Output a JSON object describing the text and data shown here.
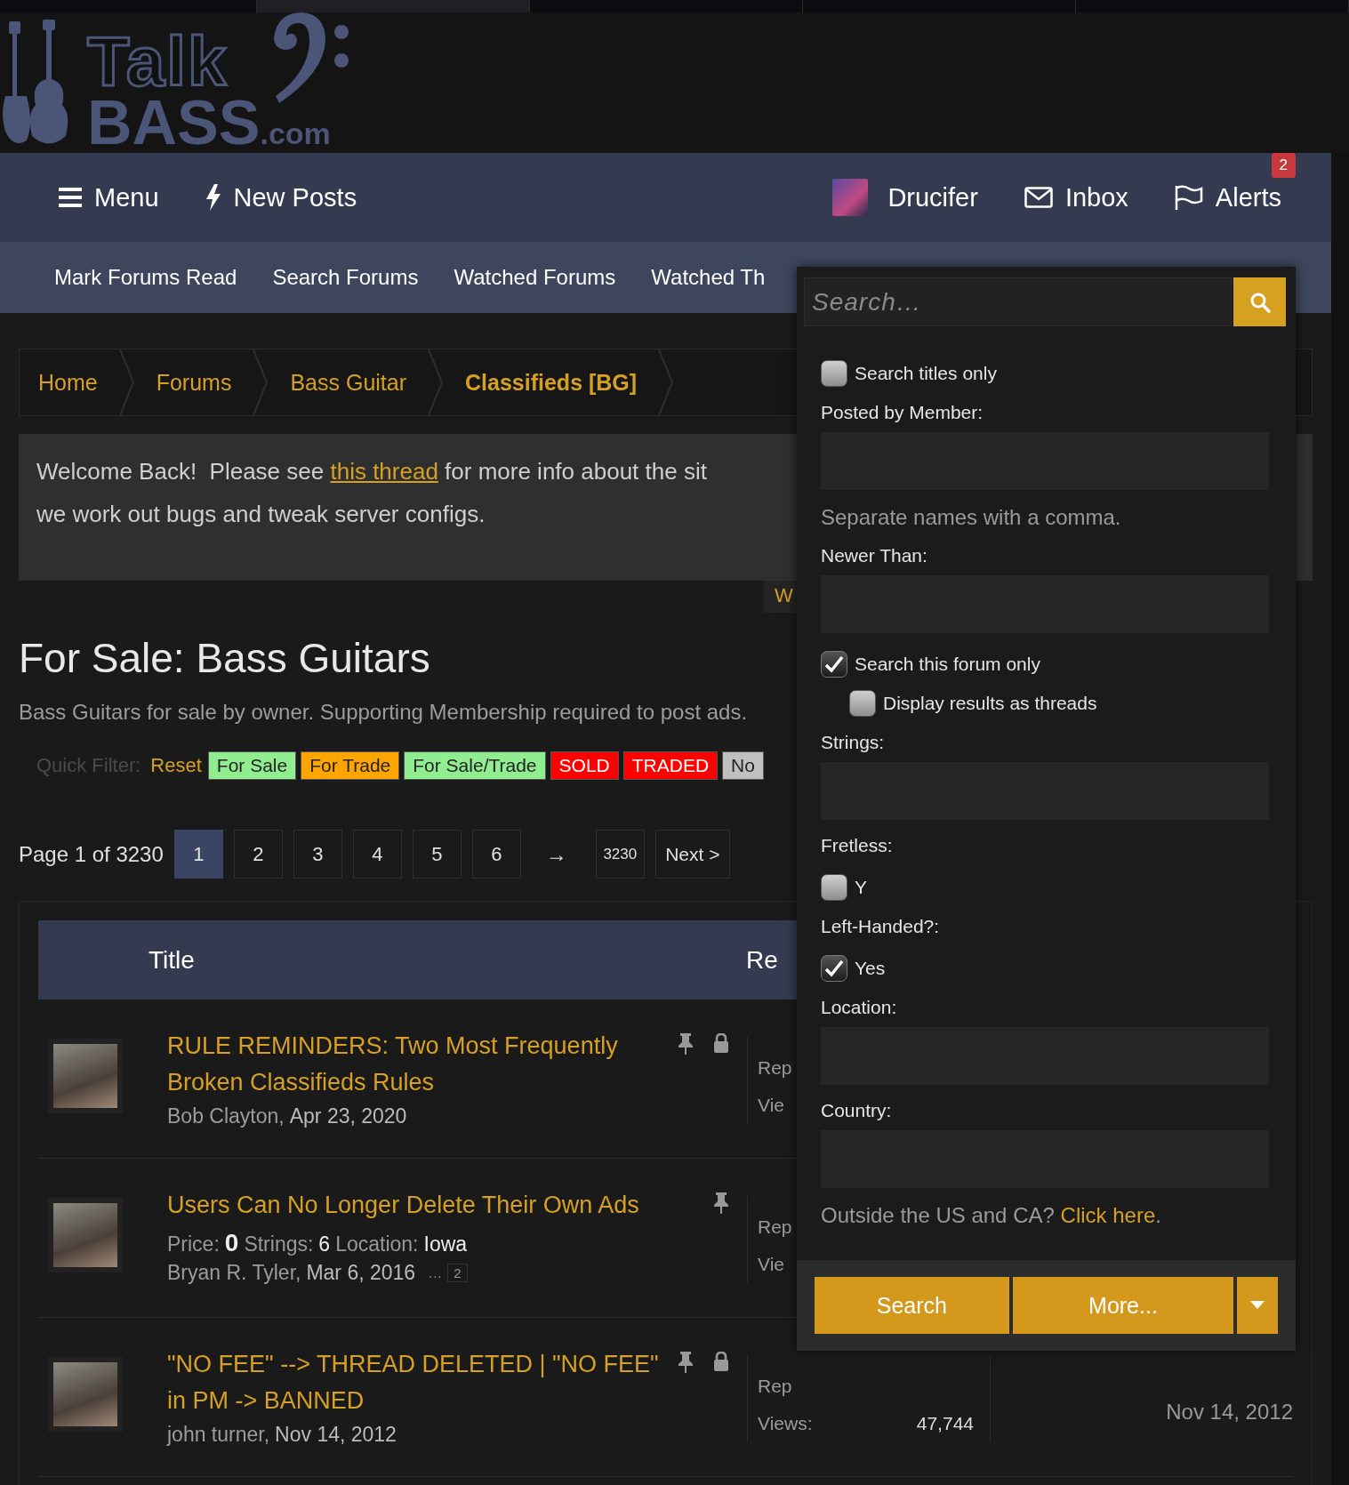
{
  "logo": {
    "word_top": "Talk",
    "word_bottom": "BASS",
    "suffix": ".com"
  },
  "nav": {
    "left": [
      {
        "label": "Menu"
      },
      {
        "label": "New Posts"
      }
    ],
    "user": "Drucifer",
    "right": [
      {
        "label": "Inbox"
      },
      {
        "label": "Alerts",
        "badge": "2"
      }
    ]
  },
  "subnav": [
    "Mark Forums Read",
    "Search Forums",
    "Watched Forums",
    "Watched Th"
  ],
  "breadcrumb": [
    {
      "label": "Home",
      "current": false
    },
    {
      "label": "Forums",
      "current": false
    },
    {
      "label": "Bass Guitar",
      "current": false
    },
    {
      "label": "Classifieds [BG]",
      "current": true
    }
  ],
  "notice": {
    "before": "Welcome Back!  Please see",
    "link": "this thread",
    "after": "for more info about the sit",
    "line2": "we work out bugs and tweak server configs."
  },
  "notice_tab": "W",
  "page_title": "For Sale: Bass Guitars",
  "description": "Bass Guitars for sale by owner. Supporting Membership required to post ads.",
  "quick_filter": {
    "label": "Quick Filter:",
    "reset": "Reset",
    "tags": [
      {
        "label": "For Sale",
        "color": "#90ee90"
      },
      {
        "label": "For Trade",
        "color": "#ffa500"
      },
      {
        "label": "For Sale/Trade",
        "color": "#90ee90"
      },
      {
        "label": "SOLD",
        "color": "#ff0000"
      },
      {
        "label": "TRADED",
        "color": "#ff0000"
      },
      {
        "label": "No",
        "color": "#c0c0c0"
      }
    ]
  },
  "pagination": {
    "summary": "Page 1 of 3230",
    "pages": [
      {
        "label": "1",
        "selected": true
      },
      {
        "label": "2",
        "selected": false
      },
      {
        "label": "3",
        "selected": false
      },
      {
        "label": "4",
        "selected": false
      },
      {
        "label": "5",
        "selected": false
      },
      {
        "label": "6",
        "selected": false
      }
    ],
    "arrow": "→",
    "last": "3230",
    "next": "Next >"
  },
  "table": {
    "columns": [
      "Title",
      "Re"
    ],
    "rows": [
      {
        "title": "RULE REMINDERS: Two Most Frequently Broken Classifieds Rules",
        "pinned": true,
        "locked": true,
        "author": "Bob Clayton,",
        "date": "Apr 23, 2020",
        "stats": [
          {
            "label": "Rep"
          },
          {
            "label": "Vie"
          }
        ]
      },
      {
        "title": "Users Can No Longer Delete Their Own Ads",
        "pinned": true,
        "locked": false,
        "fields": [
          {
            "label": "Price:",
            "value": "0"
          },
          {
            "label": "Strings:",
            "value": "6"
          },
          {
            "label": "Location:",
            "value": "Iowa"
          }
        ],
        "author": "Bryan R. Tyler,",
        "date": "Mar 6, 2016",
        "ellipsis": "…",
        "pages": [
          "2"
        ],
        "stats": [
          {
            "label": "Rep"
          },
          {
            "label": "Vie"
          }
        ]
      },
      {
        "title": "\"NO FEE\" --> THREAD DELETED | \"NO FEE\" in PM -> BANNED",
        "pinned": true,
        "locked": true,
        "author": "john turner,",
        "date": "Nov 14, 2012",
        "stats": [
          {
            "label": "Rep"
          },
          {
            "label": "Views:",
            "value": "47,744"
          }
        ],
        "last_date": "Nov 14, 2012"
      }
    ]
  },
  "search_dropdown": {
    "placeholder": "Search…",
    "items": [
      {
        "kind": "checkbox",
        "label": "Search titles only",
        "checked": false
      },
      {
        "kind": "label",
        "label": "Posted by Member:"
      },
      {
        "kind": "field"
      },
      {
        "kind": "hint",
        "label": "Separate names with a comma."
      },
      {
        "kind": "label",
        "label": "Newer Than:"
      },
      {
        "kind": "field"
      },
      {
        "kind": "checkbox",
        "label": "Search this forum only",
        "checked": true,
        "children": [
          {
            "kind": "checkbox",
            "label": "Display results as threads",
            "checked": false
          }
        ]
      },
      {
        "kind": "label",
        "label": "Strings:"
      },
      {
        "kind": "field"
      },
      {
        "kind": "label",
        "label": "Fretless:"
      },
      {
        "kind": "checkbox",
        "label": "Y",
        "checked": false
      },
      {
        "kind": "label",
        "label": "Left-Handed?:"
      },
      {
        "kind": "checkbox",
        "label": "Yes",
        "checked": true
      },
      {
        "kind": "label",
        "label": "Location:"
      },
      {
        "kind": "field"
      },
      {
        "kind": "label",
        "label": "Country:"
      },
      {
        "kind": "field"
      },
      {
        "kind": "hint",
        "label": "Outside the US and CA?",
        "link": "Click here",
        "tail": "."
      }
    ],
    "buttons": [
      "Search",
      "More..."
    ]
  }
}
